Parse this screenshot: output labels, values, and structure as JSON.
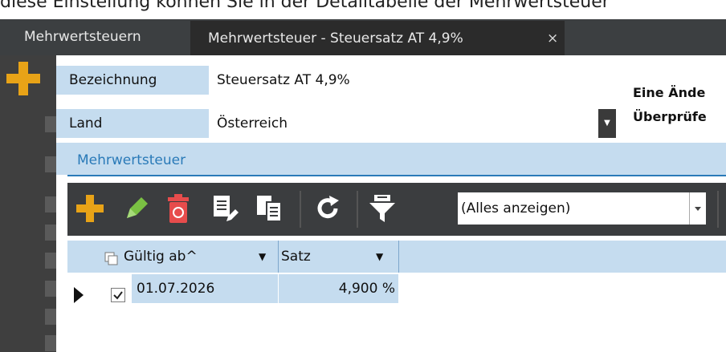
{
  "top_text": "diese Einstellung können Sie in der Detailtabelle der Mehrwertsteuer",
  "tabs": [
    {
      "label": "Mehrwertsteuern"
    },
    {
      "label": "Mehrwertsteuer - Steuersatz AT 4,9%",
      "close_icon": "×"
    }
  ],
  "form": {
    "bezeichnung_label": "Bezeichnung",
    "bezeichnung_value": "Steuersatz AT 4,9%",
    "land_label": "Land",
    "land_value": "Österreich",
    "info_line1": "Eine Ände",
    "info_line2": "Überprüfe"
  },
  "section": {
    "title": "Mehrwertsteuer"
  },
  "toolbar": {
    "icons": [
      "add-icon",
      "edit-icon",
      "delete-icon",
      "edit-document-icon",
      "copy-document-icon",
      "refresh-icon",
      "filter-icon"
    ],
    "filter_value": "(Alles anzeigen)"
  },
  "grid": {
    "columns": [
      "Gültig ab^",
      "Satz"
    ],
    "rows": [
      {
        "checked": true,
        "gueltig_ab": "01.07.2026",
        "satz": "4,900 %"
      }
    ]
  },
  "colors": {
    "tabbar": "#3c3f41",
    "panel_dark": "#3f3f3f",
    "light_blue": "#c5dcef",
    "accent_blue": "#2a7ab8",
    "toolbar": "#3b3d3f"
  }
}
